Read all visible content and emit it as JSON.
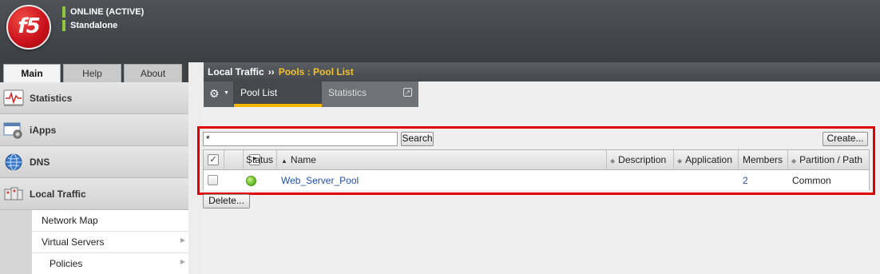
{
  "header": {
    "logo_text": "f5",
    "status_primary": "ONLINE (ACTIVE)",
    "status_secondary": "Standalone",
    "status_color": "#8cc63f"
  },
  "left_tabs": [
    {
      "label": "Main",
      "active": true
    },
    {
      "label": "Help",
      "active": false
    },
    {
      "label": "About",
      "active": false
    }
  ],
  "nav": [
    {
      "label": "Statistics",
      "icon": "statistics-icon"
    },
    {
      "label": "iApps",
      "icon": "iapps-icon"
    },
    {
      "label": "DNS",
      "icon": "dns-globe-icon"
    },
    {
      "label": "Local Traffic",
      "icon": "local-traffic-icon"
    }
  ],
  "subnav": [
    {
      "label": "Network Map",
      "has_arrow": false
    },
    {
      "label": "Virtual Servers",
      "has_arrow": true
    },
    {
      "label": "Policies",
      "has_arrow": true
    }
  ],
  "breadcrumb": {
    "section": "Local Traffic",
    "separator": "››",
    "current": "Pools : Pool List"
  },
  "subtabs": [
    {
      "label": "Pool List",
      "active": true
    },
    {
      "label": "Statistics",
      "active": false
    }
  ],
  "search": {
    "value": "*",
    "button_label": "Search"
  },
  "create_label": "Create...",
  "delete_label": "Delete...",
  "table": {
    "columns": {
      "status": "Status",
      "name": "Name",
      "description": "Description",
      "application": "Application",
      "members": "Members",
      "partition": "Partition / Path"
    },
    "rows": [
      {
        "status": "available",
        "status_color": "#6cbf2a",
        "name": "Web_Server_Pool",
        "description": "",
        "application": "",
        "members": "2",
        "partition": "Common"
      }
    ]
  },
  "colors": {
    "highlight_border": "#e00000",
    "breadcrumb_current": "#f2c12e",
    "link": "#2150a8",
    "active_tab_underline": "#f2b705"
  }
}
